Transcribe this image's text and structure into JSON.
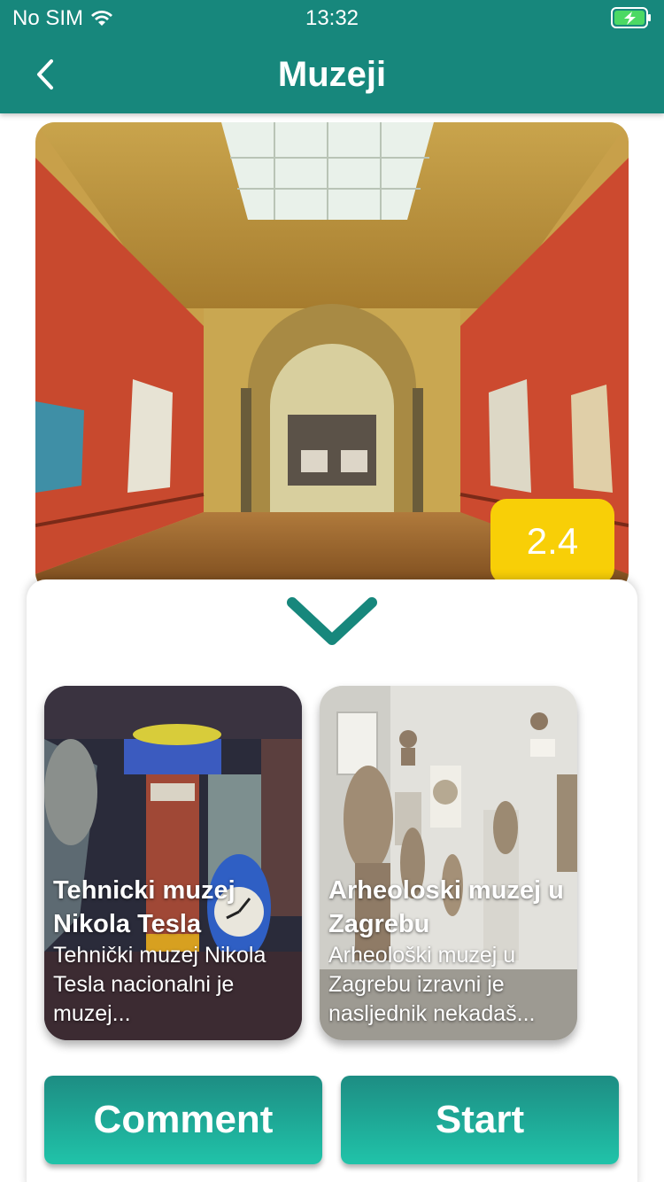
{
  "status": {
    "carrier": "No SIM",
    "time": "13:32"
  },
  "header": {
    "title": "Muzeji"
  },
  "hero": {
    "rating": "2.4"
  },
  "cards": [
    {
      "title": "Tehnicki muzej Nikola Tesla",
      "description": "Tehnički muzej Nikola Tesla nacionalni je muzej..."
    },
    {
      "title": "Arheoloski muzej u Zagrebu",
      "description": "Arheološki muzej u Zagrebu izravni je nasljednik nekadaš..."
    }
  ],
  "buttons": {
    "comment": "Comment",
    "start": "Start"
  },
  "colors": {
    "header": "#17877c",
    "badge": "#f8cf07",
    "accent": "#1d8d83",
    "button_gradient_end": "#20c3a9"
  }
}
